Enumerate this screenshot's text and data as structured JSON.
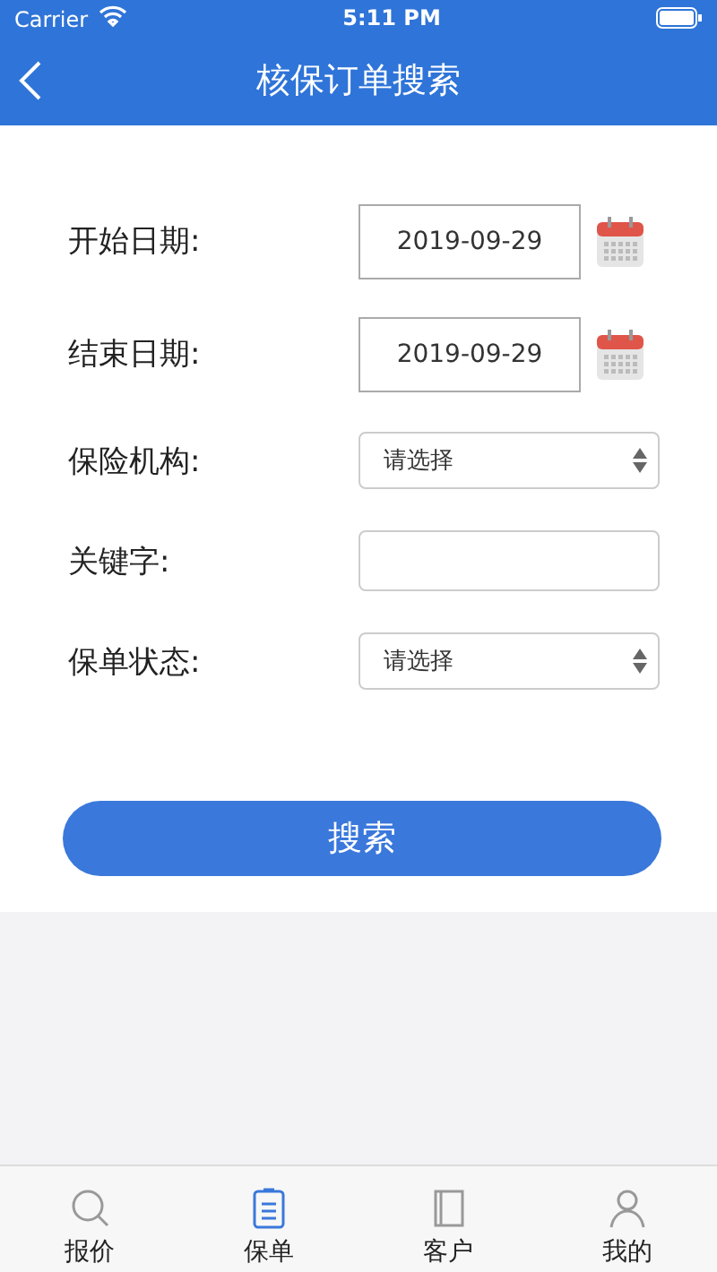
{
  "status_bar": {
    "carrier": "Carrier",
    "time": "5:11 PM"
  },
  "nav_bar": {
    "title": "核保订单搜索"
  },
  "fields": [
    {
      "kind": "date",
      "label": "开始日期:",
      "value": "2019-09-29"
    },
    {
      "kind": "date",
      "label": "结束日期:",
      "value": "2019-09-29"
    },
    {
      "kind": "select",
      "label": "保险机构:",
      "value": "请选择"
    },
    {
      "kind": "text",
      "label": "关键字:"
    },
    {
      "kind": "select",
      "label": "保单状态:",
      "value": "请选择"
    }
  ],
  "search_button": "搜索",
  "tab_bar": [
    {
      "kind": "search",
      "label": "报价",
      "selected": false
    },
    {
      "kind": "clipboard",
      "label": "保单",
      "selected": true
    },
    {
      "kind": "book",
      "label": "客户",
      "selected": false
    },
    {
      "kind": "person",
      "label": "我的",
      "selected": false
    }
  ]
}
